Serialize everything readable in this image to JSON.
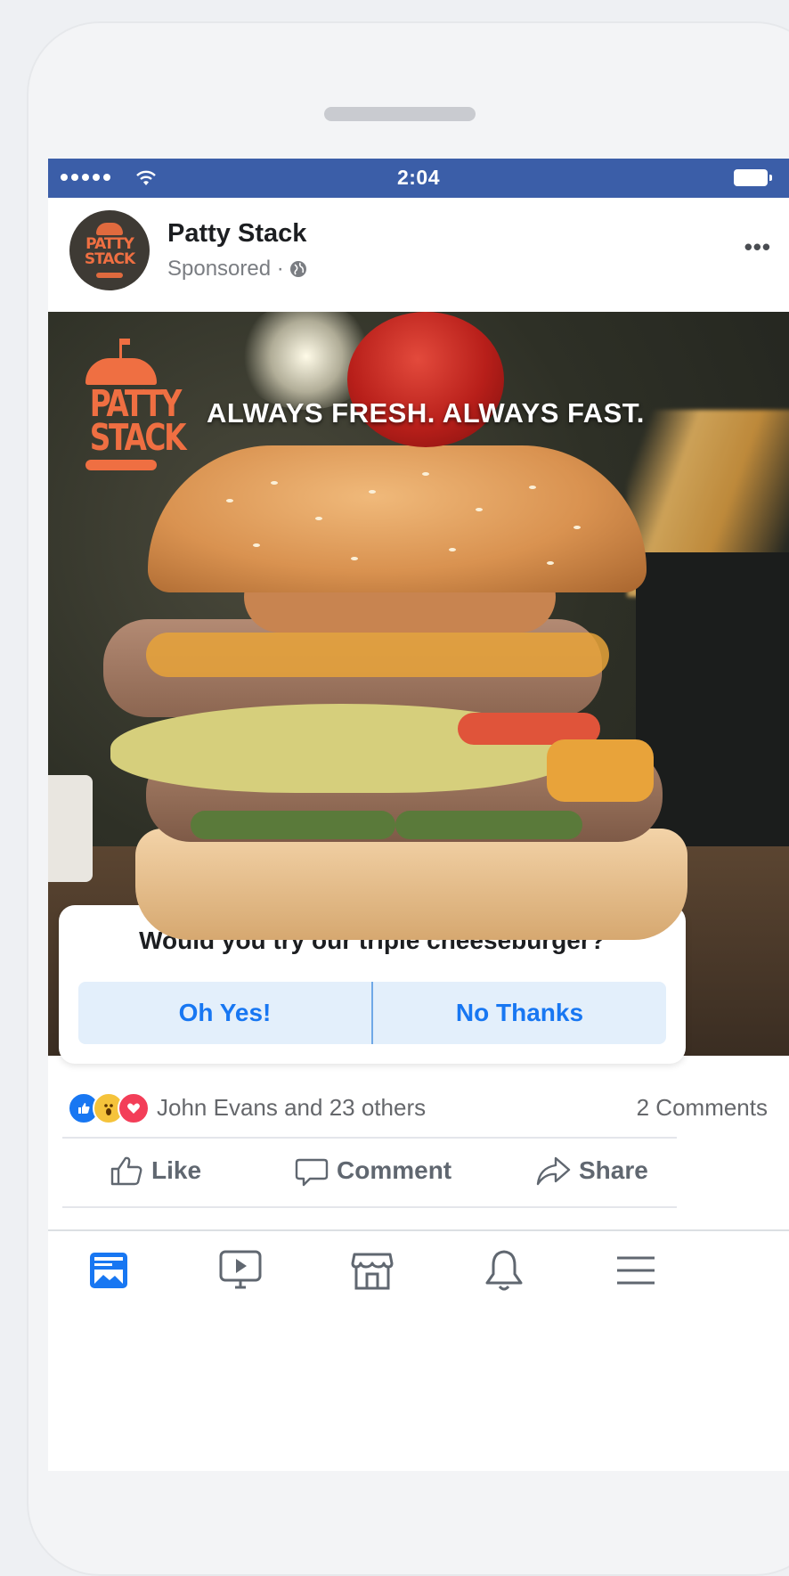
{
  "status_bar": {
    "time": "2:04"
  },
  "post": {
    "page_name": "Patty Stack",
    "sponsored": "Sponsored ·",
    "avatar_text": "PATTY\nSTACK",
    "more": "•••"
  },
  "ad": {
    "tagline": "ALWAYS FRESH. ALWAYS FAST.",
    "logo_text": "PATTY\nSTACK"
  },
  "poll": {
    "question": "Would you try our triple cheeseburger?",
    "options": [
      "Oh Yes!",
      "No Thanks"
    ]
  },
  "engagement": {
    "reactions_text": "John Evans and 23 others",
    "comments": "2 Comments",
    "reaction_icons": [
      "like-icon",
      "wow-icon",
      "love-icon"
    ]
  },
  "actions": {
    "like": "Like",
    "comment": "Comment",
    "share": "Share"
  },
  "tabbar": {
    "tabs": [
      "news-feed-icon",
      "watch-icon",
      "marketplace-icon",
      "notifications-icon",
      "menu-icon"
    ],
    "active_color": "#1877f2"
  },
  "colors": {
    "status_bar": "#3b5ea8",
    "brand_orange": "#ef6f42",
    "link_blue": "#1877f2"
  }
}
